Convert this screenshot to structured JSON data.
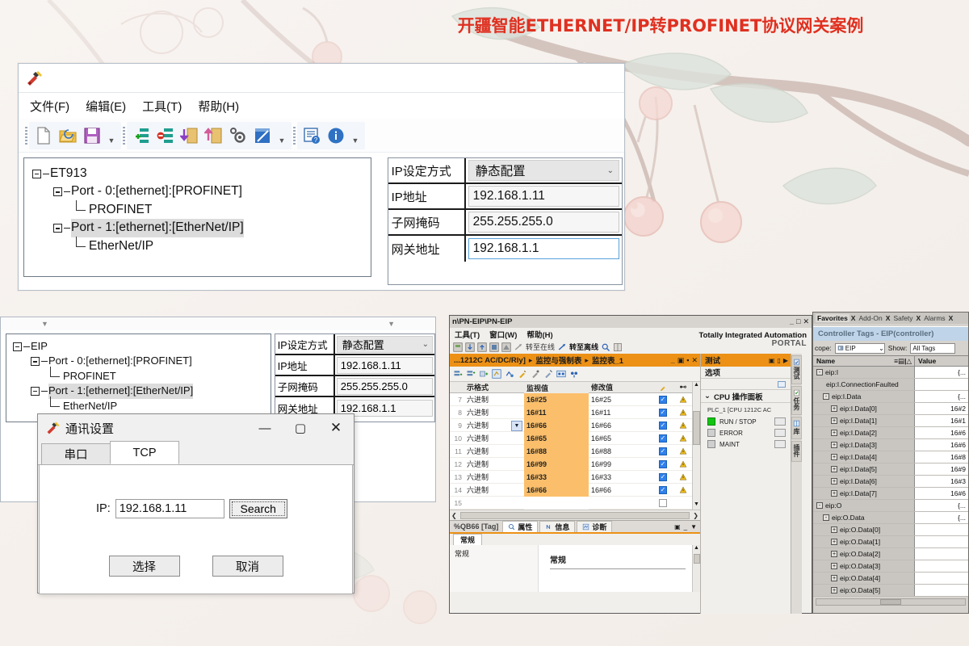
{
  "banner": {
    "title": "开疆智能ETHERNET/IP转PROFINET协议网关案例"
  },
  "gateway_config_window": {
    "menu": [
      {
        "label": "文件(F)"
      },
      {
        "label": "编辑(E)"
      },
      {
        "label": "工具(T)"
      },
      {
        "label": "帮助(H)"
      }
    ],
    "toolbar_icons": [
      "new-file-icon",
      "open-folder-icon",
      "save-disk-icon",
      "add-node-icon",
      "delete-node-icon",
      "download-icon",
      "upload-icon",
      "settings-gear-icon",
      "notepad-icon",
      "help-list-icon",
      "info-icon"
    ],
    "tree": {
      "root": "ET913",
      "nodes": [
        {
          "label": "Port - 0:[ethernet]:[PROFINET]",
          "level": 2,
          "selected": false
        },
        {
          "label": "PROFINET",
          "level": 3,
          "selected": false
        },
        {
          "label": "Port - 1:[ethernet]:[EtherNet/IP]",
          "level": 2,
          "selected": true
        },
        {
          "label": "EtherNet/IP",
          "level": 3,
          "selected": false
        }
      ]
    },
    "properties": [
      {
        "label": "IP设定方式",
        "value": "静态配置",
        "type": "select"
      },
      {
        "label": "IP地址",
        "value": "192.168.1.11",
        "type": "text"
      },
      {
        "label": "子网掩码",
        "value": "255.255.255.0",
        "type": "text"
      },
      {
        "label": "网关地址",
        "value": "192.168.1.1",
        "type": "text",
        "focused": true
      }
    ]
  },
  "eip_config_window": {
    "tree": {
      "root": "EIP",
      "nodes": [
        {
          "label": "Port - 0:[ethernet]:[PROFINET]",
          "level": 2,
          "selected": false
        },
        {
          "label": "PROFINET",
          "level": 3,
          "selected": false
        },
        {
          "label": "Port - 1:[ethernet]:[EtherNet/IP]",
          "level": 2,
          "selected": true
        },
        {
          "label": "EtherNet/IP",
          "level": 3,
          "selected": false
        }
      ]
    },
    "properties": [
      {
        "label": "IP设定方式",
        "value": "静态配置",
        "type": "select"
      },
      {
        "label": "IP地址",
        "value": "192.168.1.11",
        "type": "text"
      },
      {
        "label": "子网掩码",
        "value": "255.255.255.0",
        "type": "text"
      },
      {
        "label": "网关地址",
        "value": "192.168.1.1",
        "type": "text"
      }
    ]
  },
  "comm_dialog": {
    "title": "通讯设置",
    "window_buttons": {
      "minimize": "—",
      "maximize": "▢",
      "close": "✕"
    },
    "tabs": [
      {
        "label": "串口",
        "active": false
      },
      {
        "label": "TCP",
        "active": true
      }
    ],
    "ip_label": "IP:",
    "ip_value": "192.168.1.11",
    "search_button": "Search",
    "ok_button": "选择",
    "cancel_button": "取消"
  },
  "tia_portal": {
    "title": "n\\PN-EIP\\PN-EIP",
    "window_buttons": {
      "minimize": "_",
      "maximize": "□",
      "close": "✕"
    },
    "menu": [
      {
        "label": "工具(T)"
      },
      {
        "label": "窗口(W)"
      },
      {
        "label": "帮助(H)"
      }
    ],
    "toolbar": {
      "go_online": "转至在线",
      "go_offline": "转至离线"
    },
    "brand": {
      "line1": "Totally Integrated Automation",
      "line2": "PORTAL"
    },
    "document_tab": {
      "crumbs": [
        "...1212C AC/DC/Rly]",
        "监控与强制表",
        "监控表_1"
      ],
      "separator": "▸"
    },
    "watch_table": {
      "columns": [
        "示格式",
        "监视值",
        "修改值"
      ],
      "rows": [
        {
          "num": "7",
          "format": "六进制",
          "monitor": "16#25",
          "modify": "16#25",
          "checked": true,
          "warn": true,
          "dropdown": false
        },
        {
          "num": "8",
          "format": "六进制",
          "monitor": "16#11",
          "modify": "16#11",
          "checked": true,
          "warn": true,
          "dropdown": false
        },
        {
          "num": "9",
          "format": "六进制",
          "monitor": "16#66",
          "modify": "16#66",
          "checked": true,
          "warn": true,
          "dropdown": true
        },
        {
          "num": "10",
          "format": "六进制",
          "monitor": "16#65",
          "modify": "16#65",
          "checked": true,
          "warn": true,
          "dropdown": false
        },
        {
          "num": "11",
          "format": "六进制",
          "monitor": "16#88",
          "modify": "16#88",
          "checked": true,
          "warn": true,
          "dropdown": false
        },
        {
          "num": "12",
          "format": "六进制",
          "monitor": "16#99",
          "modify": "16#99",
          "checked": true,
          "warn": true,
          "dropdown": false
        },
        {
          "num": "13",
          "format": "六进制",
          "monitor": "16#33",
          "modify": "16#33",
          "checked": true,
          "warn": true,
          "dropdown": false
        },
        {
          "num": "14",
          "format": "六进制",
          "monitor": "16#66",
          "modify": "16#66",
          "checked": true,
          "warn": true,
          "dropdown": false
        },
        {
          "num": "15",
          "format": "",
          "monitor": "",
          "modify": "",
          "checked": false,
          "warn": false,
          "dropdown": false
        }
      ]
    },
    "bottom_panel": {
      "tag_label": "%QB66 [Tag]",
      "tabs": [
        {
          "label": "属性",
          "icon": "properties-icon",
          "active": true
        },
        {
          "label": "信息",
          "icon": "info-icon",
          "active": false
        },
        {
          "label": "诊断",
          "icon": "diagnostics-icon",
          "active": false
        }
      ],
      "subtab": "常规",
      "nav_item": "常规",
      "pane_title": "常规"
    },
    "test_panel": {
      "header": "测试",
      "options_label": "选项",
      "cpu_panel_label": "CPU 操作面板",
      "plc_name": "PLC_1 [CPU 1212C AC",
      "leds": [
        {
          "label": "RUN / STOP",
          "state": "on"
        },
        {
          "label": "ERROR",
          "state": "off"
        },
        {
          "label": "MAINT",
          "state": "off"
        }
      ]
    },
    "vertical_tabs": [
      {
        "label": "测试",
        "icon": "test-icon"
      },
      {
        "label": "任务",
        "icon": "tasks-icon"
      },
      {
        "label": "库",
        "icon": "library-icon"
      },
      {
        "label": "插件",
        "icon": "addin-icon"
      }
    ]
  },
  "rslogix": {
    "tabs": [
      "Favorites",
      "Add-On",
      "Safety",
      "Alarms"
    ],
    "tab_separator": "X",
    "title": "Controller Tags - EIP(controller)",
    "scope_label": "cope:",
    "scope_value": "EIP",
    "show_label": "Show:",
    "show_value": "All Tags",
    "columns": [
      "Name",
      "Value"
    ],
    "sort_marks": "≡▤|△",
    "rows": [
      {
        "name": "eip:I",
        "value": "{...",
        "indent": 0,
        "expander": "-"
      },
      {
        "name": "eip:I.ConnectionFaulted",
        "value": "",
        "indent": 1,
        "expander": ""
      },
      {
        "name": "eip:I.Data",
        "value": "{...",
        "indent": 1,
        "expander": "-"
      },
      {
        "name": "eip:I.Data[0]",
        "value": "16#2",
        "indent": 2,
        "expander": "+"
      },
      {
        "name": "eip:I.Data[1]",
        "value": "16#1",
        "indent": 2,
        "expander": "+"
      },
      {
        "name": "eip:I.Data[2]",
        "value": "16#6",
        "indent": 2,
        "expander": "+"
      },
      {
        "name": "eip:I.Data[3]",
        "value": "16#6",
        "indent": 2,
        "expander": "+"
      },
      {
        "name": "eip:I.Data[4]",
        "value": "16#8",
        "indent": 2,
        "expander": "+"
      },
      {
        "name": "eip:I.Data[5]",
        "value": "16#9",
        "indent": 2,
        "expander": "+"
      },
      {
        "name": "eip:I.Data[6]",
        "value": "16#3",
        "indent": 2,
        "expander": "+"
      },
      {
        "name": "eip:I.Data[7]",
        "value": "16#6",
        "indent": 2,
        "expander": "+"
      },
      {
        "name": "eip:O",
        "value": "{...",
        "indent": 0,
        "expander": "-"
      },
      {
        "name": "eip:O.Data",
        "value": "{...",
        "indent": 1,
        "expander": "-"
      },
      {
        "name": "eip:O.Data[0]",
        "value": "",
        "indent": 2,
        "expander": "+"
      },
      {
        "name": "eip:O.Data[1]",
        "value": "",
        "indent": 2,
        "expander": "+"
      },
      {
        "name": "eip:O.Data[2]",
        "value": "",
        "indent": 2,
        "expander": "+"
      },
      {
        "name": "eip:O.Data[3]",
        "value": "",
        "indent": 2,
        "expander": "+"
      },
      {
        "name": "eip:O.Data[4]",
        "value": "",
        "indent": 2,
        "expander": "+"
      },
      {
        "name": "eip:O.Data[5]",
        "value": "",
        "indent": 2,
        "expander": "+"
      }
    ]
  },
  "colors": {
    "banner_red": "#e03020",
    "tia_orange": "#ec9115",
    "monitor_cell": "#fbbf6b",
    "run_led_green": "#13c413",
    "background": "#f7f2ee"
  }
}
